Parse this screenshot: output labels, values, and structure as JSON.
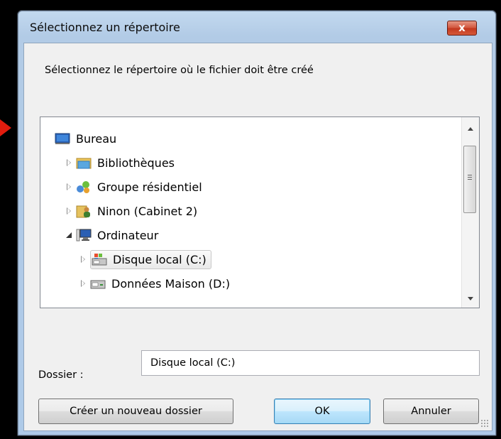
{
  "dialog": {
    "title": "Sélectionnez un répertoire",
    "close_symbol": "x",
    "instruction": "Sélectionnez le répertoire où le fichier doit être créé"
  },
  "tree": {
    "items": [
      {
        "label": "Bureau",
        "icon": "desktop-icon",
        "expander": "none",
        "level": 0
      },
      {
        "label": "Bibliothèques",
        "icon": "libraries-icon",
        "expander": "collapsed",
        "level": 1
      },
      {
        "label": "Groupe résidentiel",
        "icon": "homegroup-icon",
        "expander": "collapsed",
        "level": 1
      },
      {
        "label": "Ninon (Cabinet 2)",
        "icon": "user-folder-icon",
        "expander": "collapsed",
        "level": 1
      },
      {
        "label": "Ordinateur",
        "icon": "computer-icon",
        "expander": "expanded",
        "level": 1
      },
      {
        "label": "Disque local (C:)",
        "icon": "system-drive-icon",
        "expander": "collapsed",
        "level": 2,
        "selected": true
      },
      {
        "label": "Données Maison (D:)",
        "icon": "drive-icon",
        "expander": "collapsed",
        "level": 2
      }
    ]
  },
  "folder": {
    "label": "Dossier :",
    "value": "Disque local (C:)"
  },
  "buttons": {
    "new_folder": "Créer un nouveau dossier",
    "ok": "OK",
    "cancel": "Annuler"
  },
  "colors": {
    "arrow": "#e21c0e",
    "close_button": "#c2371e",
    "frame": "#b2cbe6"
  }
}
